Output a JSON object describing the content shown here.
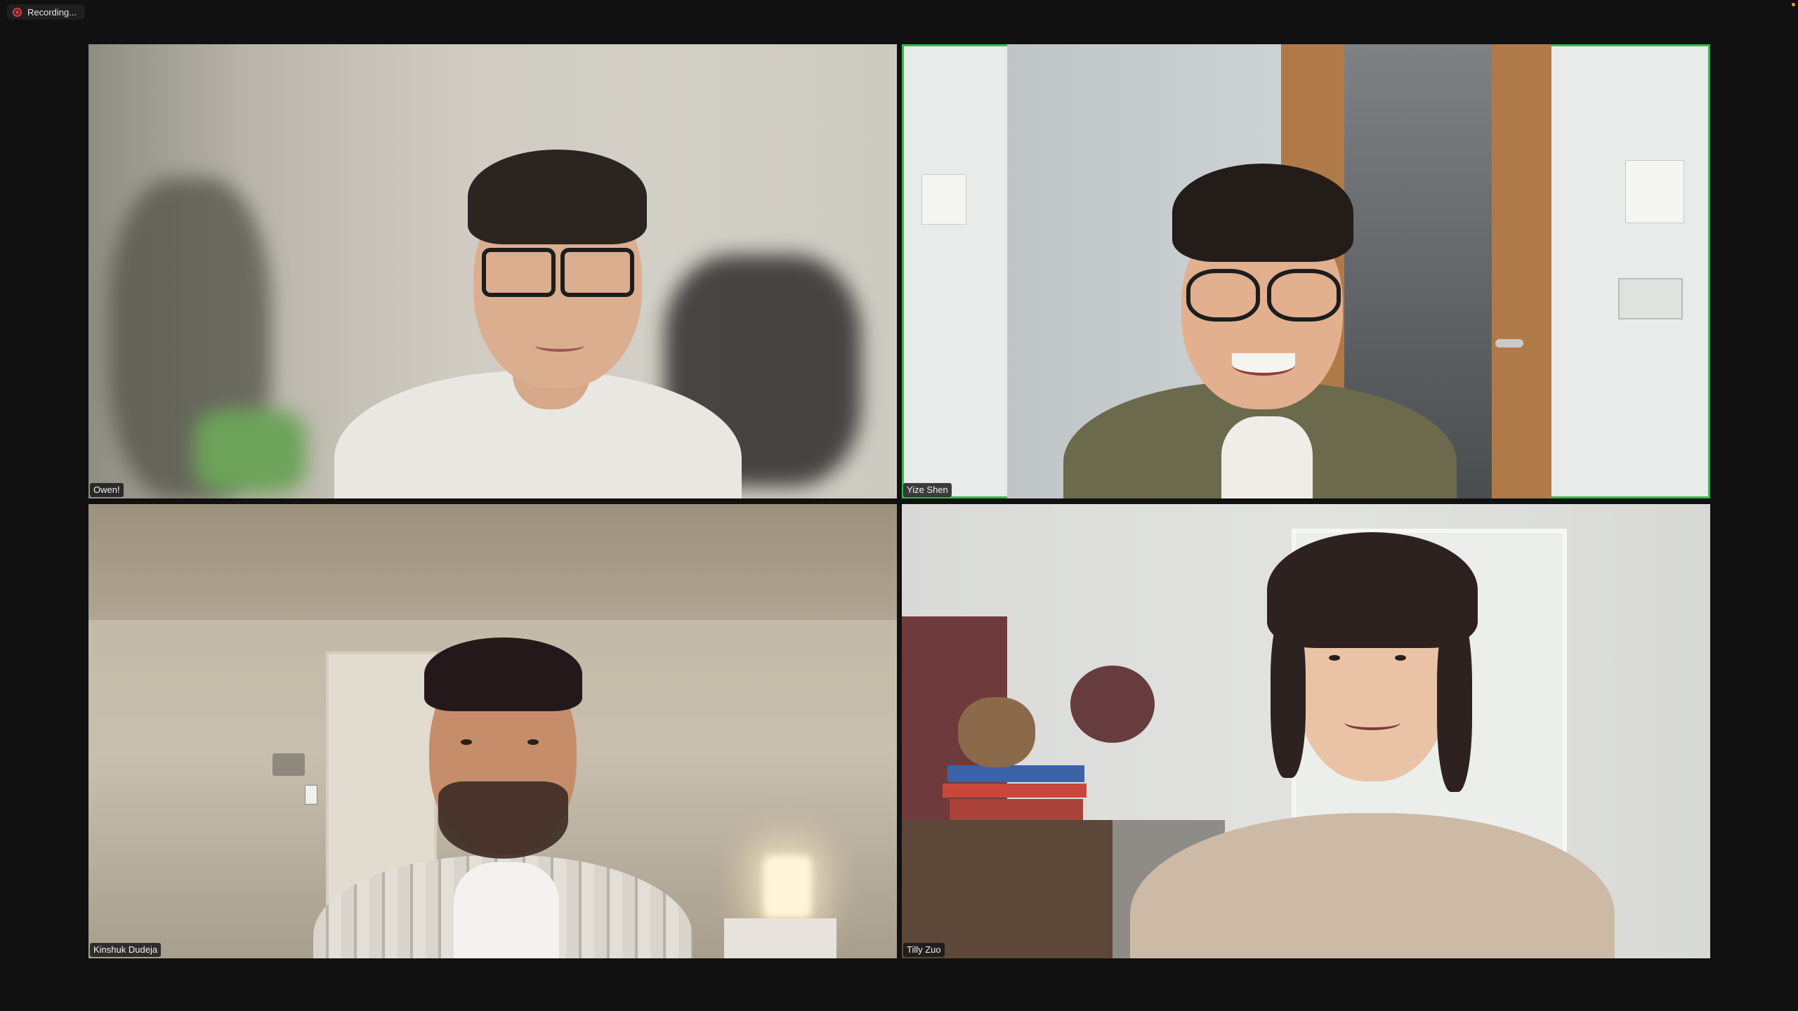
{
  "app": {
    "recording_label": "Recording..."
  },
  "colors": {
    "background": "#111112",
    "active_speaker_border": "#2fbf4a",
    "recording_red": "#e33a3a"
  },
  "participants": [
    {
      "name": "Owen!",
      "active_speaker": false
    },
    {
      "name": "Yize Shen",
      "active_speaker": true
    },
    {
      "name": "Kinshuk Dudeja",
      "active_speaker": false
    },
    {
      "name": "Tilly Zuo",
      "active_speaker": false
    }
  ]
}
